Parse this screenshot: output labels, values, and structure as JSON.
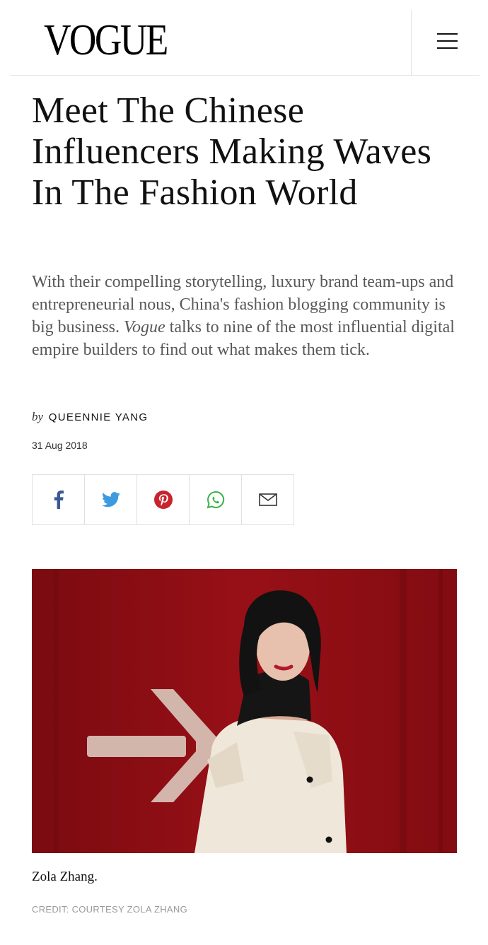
{
  "header": {
    "logo": "VOGUE",
    "menu_icon": "hamburger-menu-icon"
  },
  "article": {
    "title": "Meet The Chinese Influencers Making Waves In The Fashion World",
    "dek_part1": "With their compelling storytelling, luxury brand team-ups and entrepreneurial nous, China's fashion blogging community is big business. ",
    "dek_emphasis": "Vogue",
    "dek_part2": " talks to nine of the most influential digital empire builders to find out what makes them tick.",
    "byline_prefix": "by",
    "author": "QUEENNIE YANG",
    "date": "31 Aug 2018"
  },
  "share": {
    "buttons": [
      "facebook-icon",
      "twitter-icon",
      "pinterest-icon",
      "whatsapp-icon",
      "email-icon"
    ],
    "colors": {
      "facebook": "#3b5998",
      "twitter": "#3d9ae0",
      "pinterest": "#c8232c",
      "whatsapp": "#3bb04a",
      "email": "#333333"
    }
  },
  "image": {
    "caption": "Zola Zhang.",
    "credit": "CREDIT: COURTESY ZOLA ZHANG",
    "colors": {
      "background": "#8e0d12",
      "arrow": "#d9c4b8",
      "jacket": "#efe7d9"
    }
  }
}
